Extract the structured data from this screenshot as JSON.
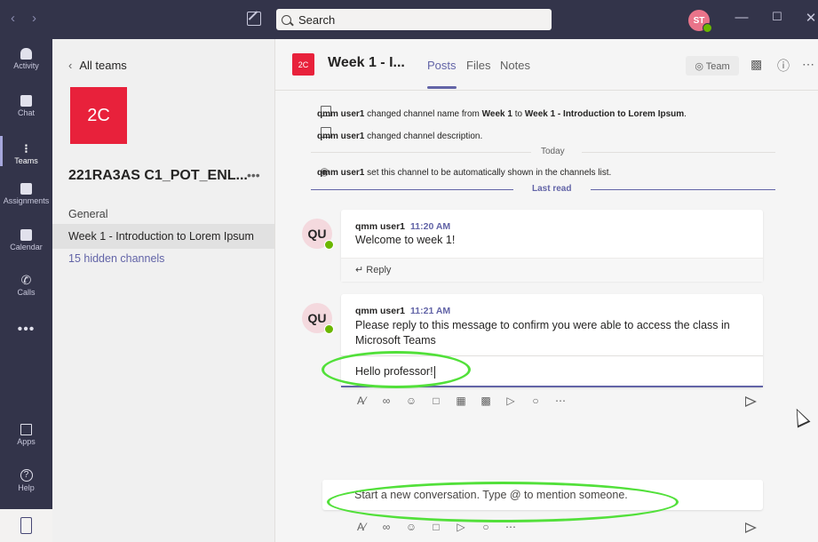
{
  "search": {
    "placeholder": "Search"
  },
  "user": {
    "initials": "ST"
  },
  "rail": {
    "items": [
      {
        "label": "Activity"
      },
      {
        "label": "Chat"
      },
      {
        "label": "Teams"
      },
      {
        "label": "Assignments"
      },
      {
        "label": "Calendar"
      },
      {
        "label": "Calls"
      },
      {
        "label": "Apps"
      },
      {
        "label": "Help"
      }
    ],
    "more": "•••"
  },
  "sidebar": {
    "back_label": "All teams",
    "team_tile": "2C",
    "team_name": "221RA3AS C1_POT_ENL...",
    "team_more": "•••",
    "channels": [
      {
        "label": "General"
      },
      {
        "label": "Week 1 - Introduction to Lorem Ipsum"
      }
    ],
    "hidden_channels": "15 hidden channels"
  },
  "header": {
    "tile": "2C",
    "title": "Week 1 - I...",
    "tabs": [
      {
        "label": "Posts"
      },
      {
        "label": "Files"
      },
      {
        "label": "Notes"
      }
    ],
    "team_button": "◎ Team"
  },
  "system": {
    "row1": {
      "user": "qmm user1",
      "pre": " changed channel name from ",
      "from": "Week 1",
      "mid": " to ",
      "to": "Week 1 - Introduction to Lorem Ipsum",
      "end": "."
    },
    "row2": {
      "user": "qmm user1",
      "text": " changed channel description."
    },
    "today": "Today",
    "row3": {
      "user": "qmm user1",
      "text": " set this channel to be automatically shown in the channels list."
    },
    "last_read": "Last read"
  },
  "messages": [
    {
      "avatar": "QU",
      "author": "qmm user1",
      "time": "11:20 AM",
      "text": "Welcome to week 1!",
      "reply_label": "Reply"
    },
    {
      "avatar": "QU",
      "author": "qmm user1",
      "time": "11:21 AM",
      "text": "Please reply to this message to confirm you were able to access the class in Microsoft Teams",
      "reply_value": "Hello professor!"
    }
  ],
  "new_conversation": {
    "placeholder": "Start a new conversation. Type @ to mention someone."
  },
  "colors": {
    "brand": "#6264a7",
    "rail": "#33344a",
    "team_tile": "#e8213b",
    "highlight": "#52e03a",
    "presence": "#6bb700"
  }
}
